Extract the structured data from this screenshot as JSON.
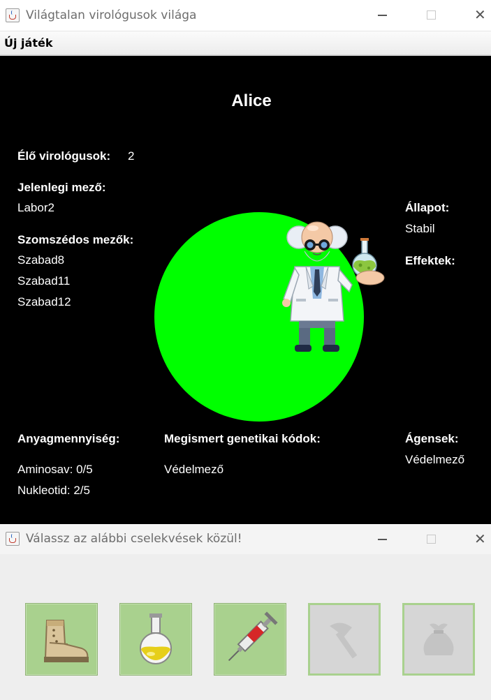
{
  "window_main": {
    "title": "Világtalan virológusok világa",
    "menu": {
      "new_game": "Új játék"
    }
  },
  "game": {
    "player_name": "Alice",
    "alive_label": "Élő virológusok:",
    "alive_count": "2",
    "current_field_label": "Jelenlegi mező:",
    "current_field": "Labor2",
    "neighbors_label": "Szomszédos mezők:",
    "neighbors": [
      "Szabad8",
      "Szabad11",
      "Szabad12"
    ],
    "state_label": "Állapot:",
    "state_value": "Stabil",
    "effects_label": "Effektek:",
    "materials_label": "Anyagmennyiség:",
    "amino": "Aminosav: 0/5",
    "nucleotide": "Nukleotid: 2/5",
    "codes_label": "Megismert genetikai kódok:",
    "codes": [
      "Védelmező"
    ],
    "agents_label": "Ágensek:",
    "agents": [
      "Védelmező"
    ],
    "field_color": "#00ff00"
  },
  "window_actions": {
    "title": "Válassz az alábbi cselekvések közül!",
    "buttons": [
      {
        "icon": "boot-icon",
        "enabled": true
      },
      {
        "icon": "flask-icon",
        "enabled": true
      },
      {
        "icon": "syringe-icon",
        "enabled": true
      },
      {
        "icon": "axe-icon",
        "enabled": false
      },
      {
        "icon": "loot-bag-icon",
        "enabled": false
      }
    ]
  },
  "colors": {
    "background": "#000000",
    "field": "#00ff00",
    "button_active": "#a9d18e",
    "button_disabled": "#d6d6d6"
  }
}
